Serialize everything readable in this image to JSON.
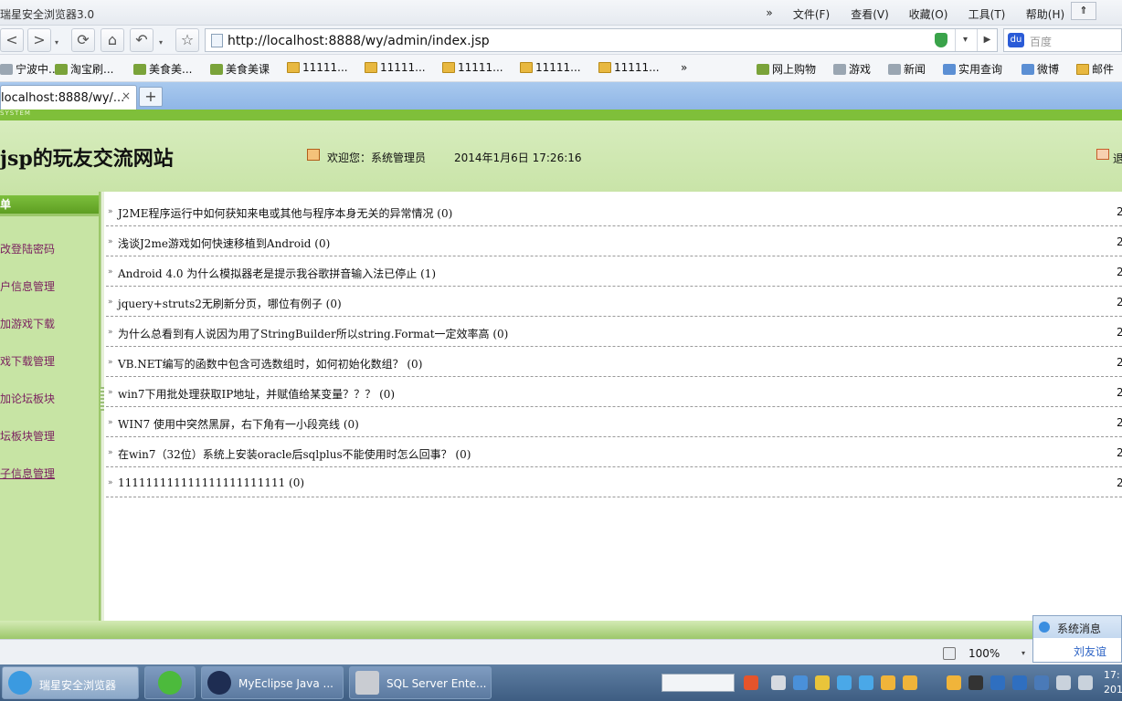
{
  "window": {
    "title": "瑞星安全浏览器3.0",
    "menu_chevron": "»",
    "menus": [
      "文件(F)",
      "查看(V)",
      "收藏(O)",
      "工具(T)",
      "帮助(H)"
    ],
    "pin": "⇑"
  },
  "toolbar": {
    "back": "<",
    "forward": ">",
    "refresh": "⟳",
    "home": "⌂",
    "undo": "↶",
    "favorite": "☆",
    "url": "http://localhost:8888/wy/admin/index.jsp",
    "search_placeholder": "百度",
    "search_logo": "du"
  },
  "favorites": {
    "items": [
      {
        "label": "宁波中...",
        "icon": "gray"
      },
      {
        "label": "淘宝刷...",
        "icon": "green"
      },
      {
        "label": "美食美...",
        "icon": "green"
      },
      {
        "label": "美食美课",
        "icon": "green"
      },
      {
        "label": "11111...",
        "icon": "folder"
      },
      {
        "label": "11111...",
        "icon": "folder"
      },
      {
        "label": "11111...",
        "icon": "folder"
      },
      {
        "label": "11111...",
        "icon": "folder"
      },
      {
        "label": "11111...",
        "icon": "folder"
      }
    ],
    "more": "»",
    "right_items": [
      "网上购物",
      "游戏",
      "新闻",
      "实用查询",
      "微博",
      "邮件"
    ]
  },
  "tabs": {
    "active_title": "localhost:8888/wy/...",
    "close": "×",
    "new": "+"
  },
  "page": {
    "strip_text": "SYSTEM",
    "site_title": "jsp的玩友交流网站",
    "welcome": "欢迎您：系统管理员",
    "datetime": "2014年1月6日  17:26:16",
    "logout": "退"
  },
  "sidebar": {
    "header": "菜单",
    "items": [
      "修改登陆密码",
      "用户信息管理",
      "添加游戏下载",
      "游戏下载管理",
      "添加论坛板块",
      "论坛板块管理",
      "帖子信息管理"
    ]
  },
  "posts": {
    "arrow": "»",
    "rows": [
      {
        "title": "J2ME程序运行中如何获知来电或其他与程序本身无关的异常情况  (0)",
        "date": "2"
      },
      {
        "title": "浅谈J2me游戏如何快速移植到Android (0)",
        "date": "2"
      },
      {
        "title": "Android 4.0 为什么模拟器老是提示我谷歌拼音输入法已停止  (1)",
        "date": "2"
      },
      {
        "title": "jquery+struts2无刷新分页，哪位有例子  (0)",
        "date": "2"
      },
      {
        "title": "为什么总看到有人说因为用了StringBuilder所以string.Format一定效率高  (0)",
        "date": "2"
      },
      {
        "title": "VB.NET编写的函数中包含可选数组时，如何初始化数组？  (0)",
        "date": "2"
      },
      {
        "title": "win7下用批处理获取IP地址，并赋值给某变量？？？  (0)",
        "date": "2"
      },
      {
        "title": "WIN7 使用中突然黑屏，右下角有一小段亮线  (0)",
        "date": "2"
      },
      {
        "title": "在win7（32位）系统上安装oracle后sqlplus不能使用时怎么回事？  (0)",
        "date": "2"
      },
      {
        "title": "111111111111111111111111 (0)",
        "date": "2"
      }
    ]
  },
  "statusbar": {
    "zoom": "100%",
    "zoom_drop": "▾"
  },
  "notification": {
    "title": "系统消息",
    "user": "刘友谊"
  },
  "taskbar": {
    "tasks": [
      "瑞星安全浏览器",
      "",
      "MyEclipse Java ...",
      "SQL Server Ente..."
    ],
    "clock_time": "17:",
    "clock_date": "201"
  }
}
